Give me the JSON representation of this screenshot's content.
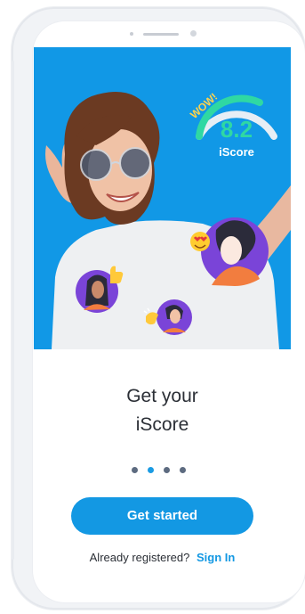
{
  "hero": {
    "badge_word": "WOW!",
    "score_value": "8.2",
    "score_label": "iScore",
    "colors": {
      "background": "#1198e6",
      "gauge_track": "#e6eef5",
      "gauge_fill": "#2fd8a3"
    },
    "icons": [
      "heart-eyes-emoji-icon",
      "thumbs-up-emoji-icon",
      "clapping-hands-emoji-icon"
    ]
  },
  "onboarding": {
    "title_line1": "Get your",
    "title_line2": "iScore",
    "page_count": 4,
    "active_page": 2
  },
  "actions": {
    "get_started": "Get started",
    "already_registered": "Already registered?",
    "sign_in": "Sign In"
  },
  "theme": {
    "accent": "#1398e3",
    "dot_inactive": "#5d6b80",
    "text": "#2b2f36"
  }
}
